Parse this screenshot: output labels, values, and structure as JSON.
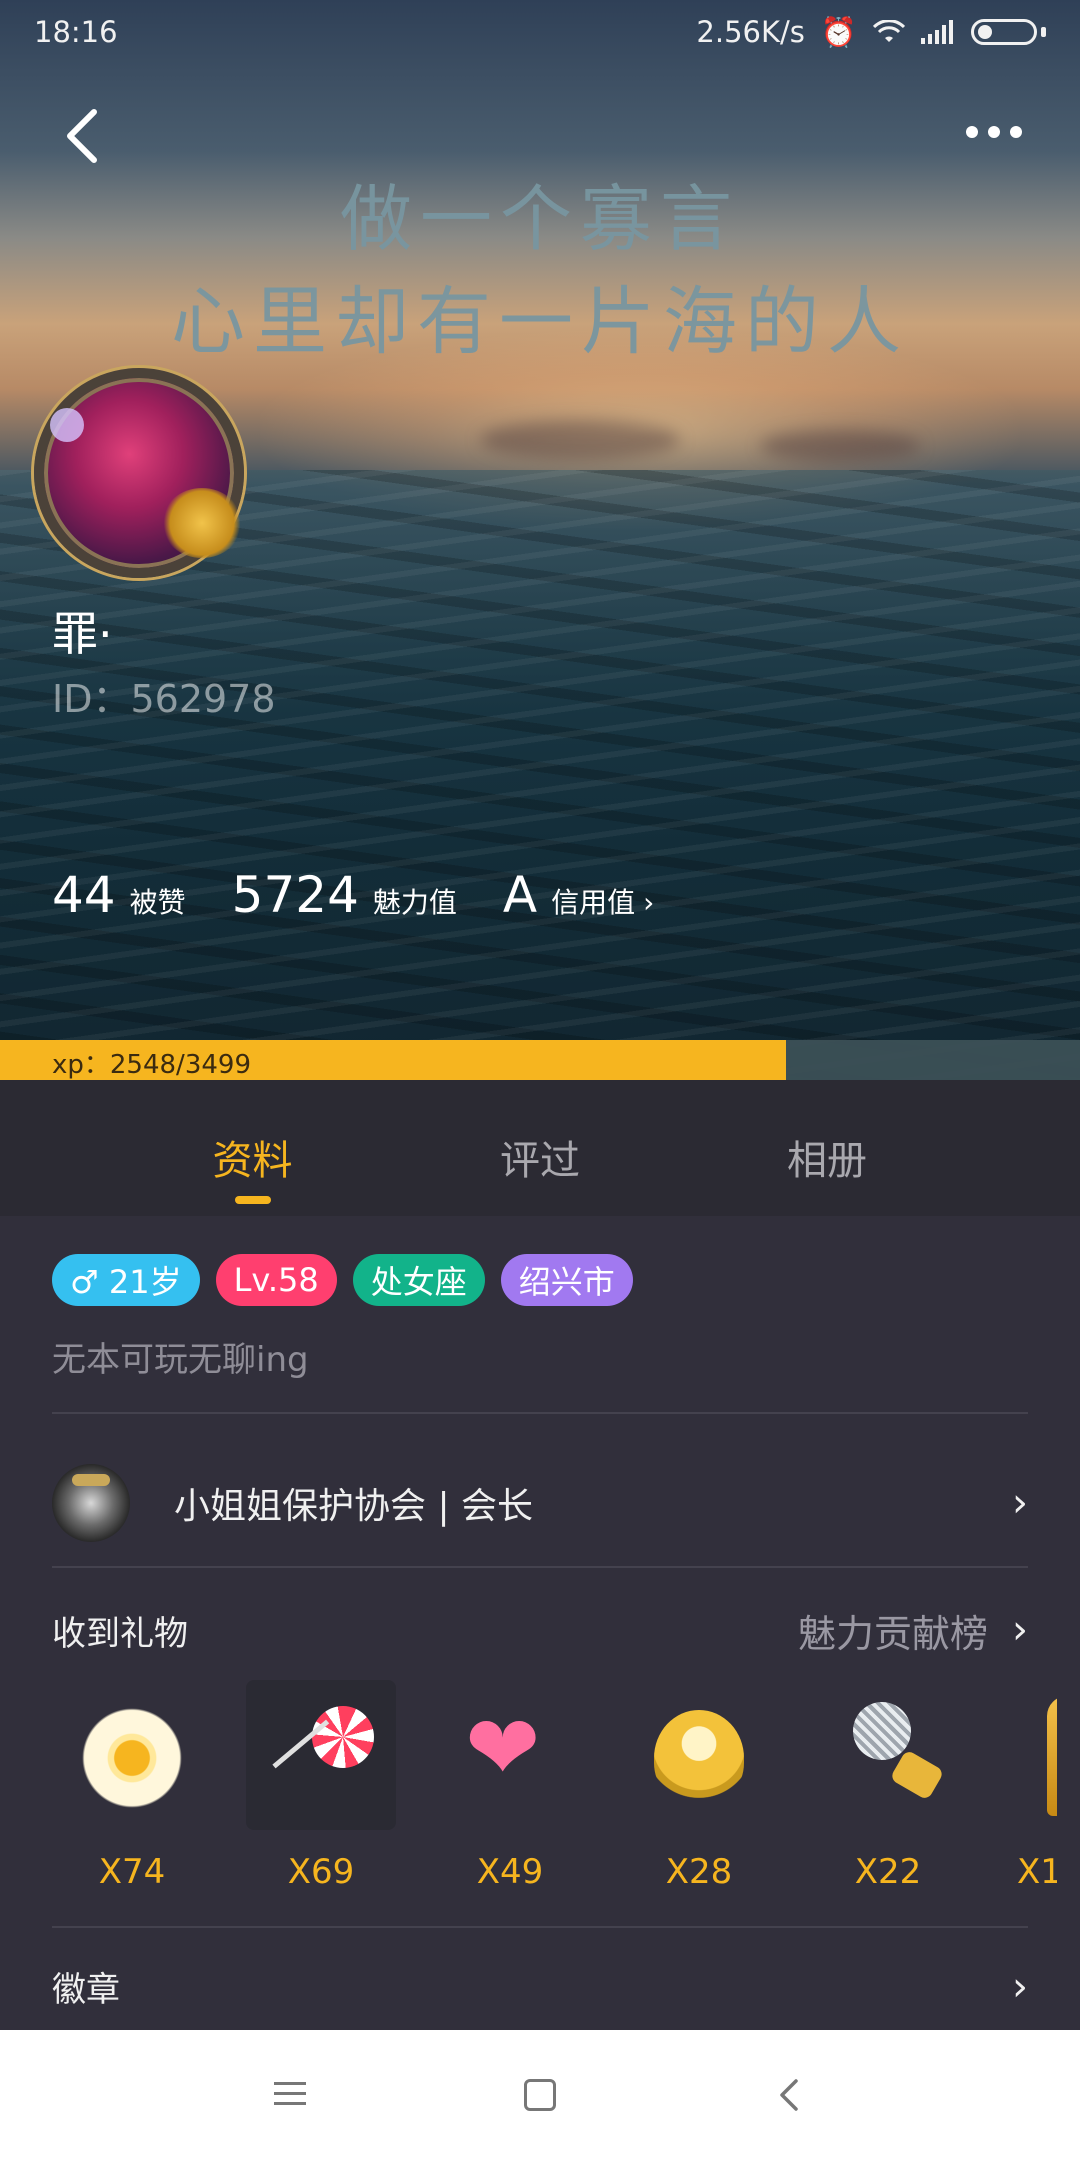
{
  "status_bar": {
    "time": "18:16",
    "net_speed": "2.56K/s"
  },
  "hero": {
    "slogan_line1": "做一个寡言",
    "slogan_line2": "心里却有一片海的人",
    "nickname": "罪·",
    "user_id": "ID：562978",
    "stats": [
      {
        "value": "44",
        "label": "被赞"
      },
      {
        "value": "5724",
        "label": "魅力值"
      },
      {
        "value": "A",
        "label": "信用值"
      }
    ],
    "xp_text": "xp：2548/3499",
    "xp_fraction": 0.728
  },
  "tabs": [
    {
      "label": "资料",
      "active": true
    },
    {
      "label": "评过",
      "active": false
    },
    {
      "label": "相册",
      "active": false
    }
  ],
  "profile": {
    "tags": {
      "gender_age": "♂ 21岁",
      "level": "Lv.58",
      "zodiac": "处女座",
      "city": "绍兴市"
    },
    "signature": "无本可玩无聊ing",
    "group_name": "小姐姐保护协会 | 会长"
  },
  "gifts_section": {
    "title": "收到礼物",
    "link": "魅力贡献榜",
    "items": [
      {
        "icon": "fried-egg-icon",
        "count": "X74"
      },
      {
        "icon": "lollipop-icon",
        "count": "X69"
      },
      {
        "icon": "winged-heart-icon",
        "count": "X49"
      },
      {
        "icon": "banana-icon",
        "count": "X28"
      },
      {
        "icon": "microphone-icon",
        "count": "X22"
      },
      {
        "icon": "trophy-icon",
        "count": "X1"
      }
    ]
  },
  "badges_section": {
    "title": "徽章"
  },
  "colors": {
    "accent": "#f6b51f",
    "bg": "#312f3b",
    "tag_gender": "#35c0f0",
    "tag_level": "#ff3f6f",
    "tag_zodiac": "#12b38a",
    "tag_city": "#a179f0"
  }
}
